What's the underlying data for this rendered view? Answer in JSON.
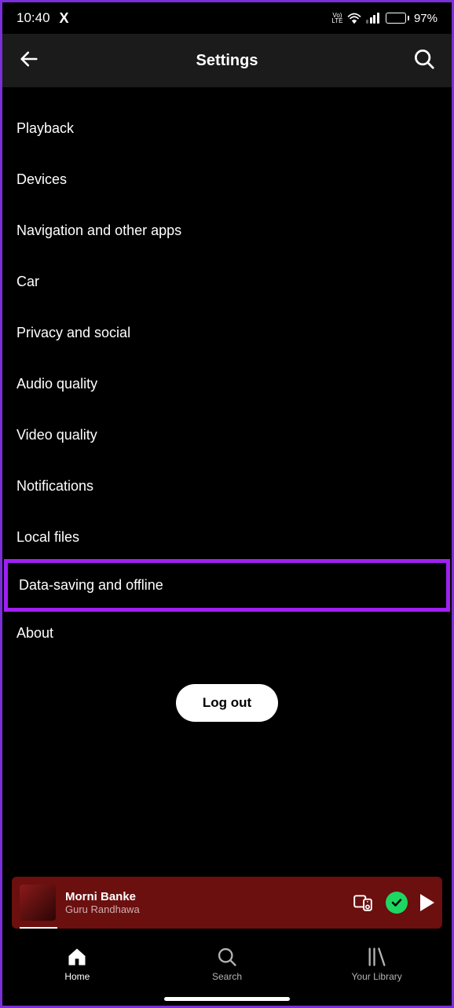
{
  "status": {
    "time": "10:40",
    "app_icon": "X",
    "network_label": "VoLTE",
    "battery_percent": "97%"
  },
  "header": {
    "title": "Settings"
  },
  "settings": {
    "items": [
      {
        "label": "Playback"
      },
      {
        "label": "Devices"
      },
      {
        "label": "Navigation and other apps"
      },
      {
        "label": "Car"
      },
      {
        "label": "Privacy and social"
      },
      {
        "label": "Audio quality"
      },
      {
        "label": "Video quality"
      },
      {
        "label": "Notifications"
      },
      {
        "label": "Local files"
      },
      {
        "label": "Data-saving and offline"
      },
      {
        "label": "About"
      }
    ],
    "highlighted_index": 9,
    "logout_label": "Log out"
  },
  "now_playing": {
    "track_title": "Morni Banke",
    "artist": "Guru Randhawa",
    "downloaded": true,
    "playing": false
  },
  "bottom_nav": {
    "items": [
      {
        "label": "Home",
        "active": true
      },
      {
        "label": "Search",
        "active": false
      },
      {
        "label": "Your Library",
        "active": false
      }
    ]
  },
  "colors": {
    "accent_green": "#1ed760",
    "nowplaying_bg": "#6b0f0f",
    "highlight_border": "#a020f0"
  }
}
